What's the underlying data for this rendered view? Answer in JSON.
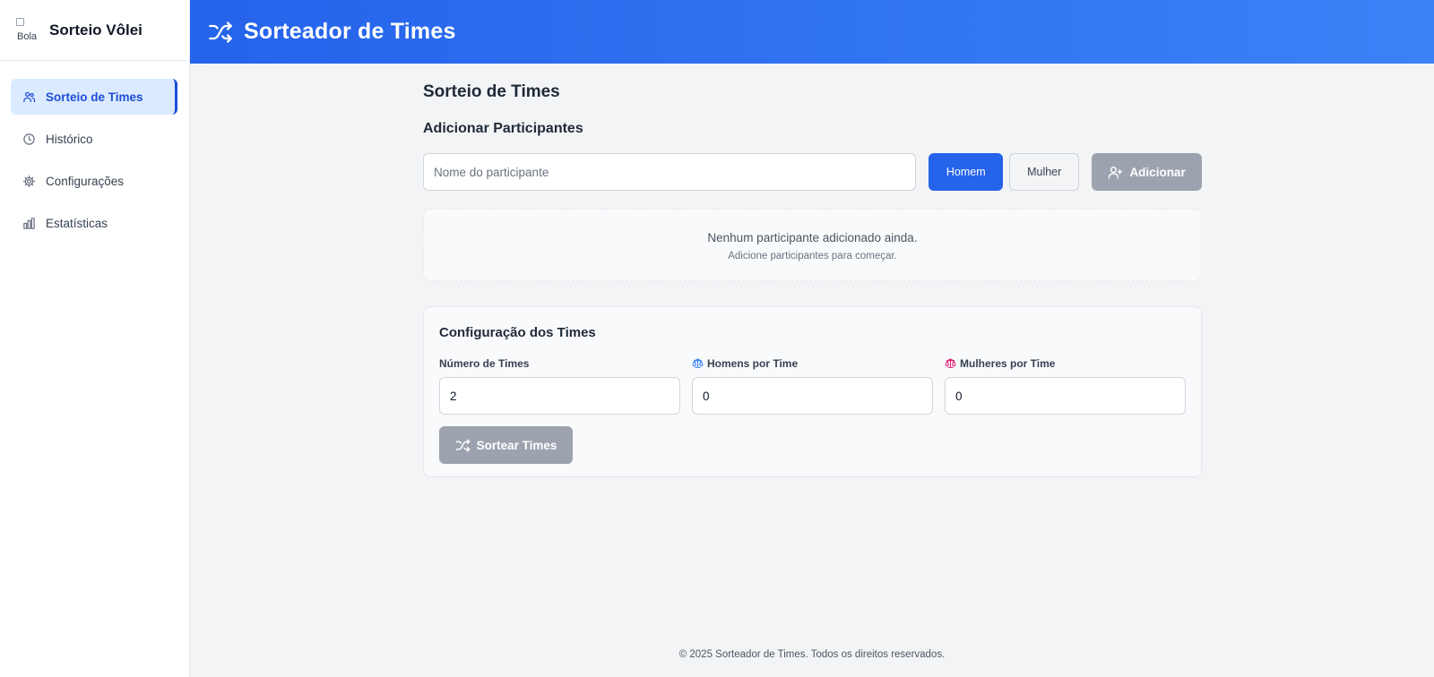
{
  "brand": {
    "logo_alt": "Bola",
    "name": "Sorteio Vôlei"
  },
  "sidebar": {
    "items": [
      {
        "label": "Sorteio de Times",
        "icon": "users-icon",
        "active": true
      },
      {
        "label": "Histórico",
        "icon": "clock-icon",
        "active": false
      },
      {
        "label": "Configurações",
        "icon": "gear-icon",
        "active": false
      },
      {
        "label": "Estatísticas",
        "icon": "bar-chart-icon",
        "active": false
      }
    ]
  },
  "header": {
    "icon": "shuffle-icon",
    "title": "Sorteador de Times"
  },
  "main": {
    "page_title": "Sorteio de Times",
    "add_section_title": "Adicionar Participantes",
    "name_input": {
      "placeholder": "Nome do participante",
      "value": ""
    },
    "gender_buttons": {
      "male": "Homem",
      "female": "Mulher",
      "selected": "Homem"
    },
    "add_button": "Adicionar",
    "empty_state": {
      "message": "Nenhum participante adicionado ainda.",
      "hint": "Adicione participantes para começar."
    },
    "config": {
      "title": "Configuração dos Times",
      "fields": [
        {
          "label": "Número de Times",
          "value": "2"
        },
        {
          "label": "Homens por Time",
          "value": "0",
          "icon": "scale-icon-male"
        },
        {
          "label": "Mulheres por Time",
          "value": "0",
          "icon": "scale-icon-female"
        }
      ],
      "sort_button": "Sortear Times"
    }
  },
  "footer": {
    "text": "© 2025 Sorteador de Times. Todos os direitos reservados."
  },
  "colors": {
    "primary": "#2563eb",
    "header_gradient_end": "#3b82f6",
    "disabled_button": "#9ca3af",
    "male_icon": "#3b82f6",
    "female_icon": "#db2777"
  }
}
